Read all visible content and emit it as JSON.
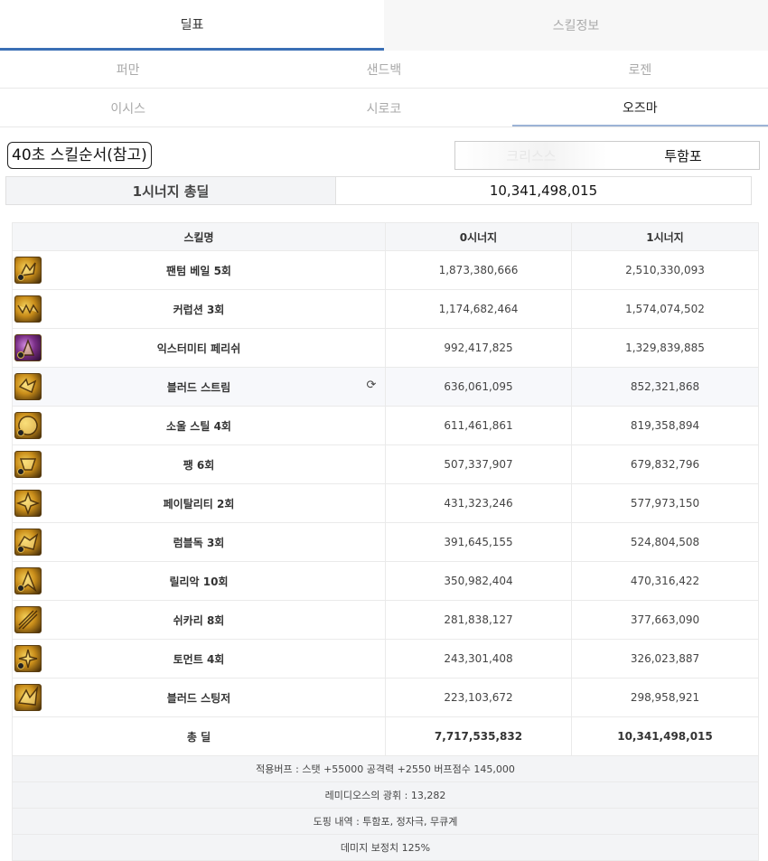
{
  "top_tabs": [
    {
      "label": "딜표",
      "active": true
    },
    {
      "label": "스킬정보",
      "active": false
    }
  ],
  "boss_rows": [
    [
      {
        "label": "퍼만",
        "active": false
      },
      {
        "label": "샌드백",
        "active": false
      },
      {
        "label": "로젠",
        "active": false
      }
    ],
    [
      {
        "label": "이시스",
        "active": false
      },
      {
        "label": "시로코",
        "active": false
      },
      {
        "label": "오즈마",
        "active": true
      }
    ]
  ],
  "skill_order_label": "40초 스킬순서(참고)",
  "mode_toggle": {
    "options": [
      "크리스스",
      "투함포"
    ],
    "selected": "투함포"
  },
  "total": {
    "label": "1시너지 총딜",
    "value": "10,341,498,015"
  },
  "table": {
    "headers": [
      "스킬명",
      "0시너지",
      "1시너지"
    ],
    "rows": [
      {
        "name": "팬텀 베일 5회",
        "s0": "1,873,380,666",
        "s1": "2,510,330,093",
        "icon": "phantom-veil-icon"
      },
      {
        "name": "커럽션 3회",
        "s0": "1,174,682,464",
        "s1": "1,574,074,502",
        "icon": "corruption-icon"
      },
      {
        "name": "익스터미티 페리쉬",
        "s0": "992,417,825",
        "s1": "1,329,839,885",
        "icon": "extremity-perish-icon"
      },
      {
        "name": "블러드 스트림",
        "s0": "636,061,095",
        "s1": "852,321,868",
        "icon": "blood-stream-icon"
      },
      {
        "name": "소울 스틸 4회",
        "s0": "611,461,861",
        "s1": "819,358,894",
        "icon": "soul-steal-icon"
      },
      {
        "name": "팽 6회",
        "s0": "507,337,907",
        "s1": "679,832,796",
        "icon": "fang-icon"
      },
      {
        "name": "페이탈리티 2회",
        "s0": "431,323,246",
        "s1": "577,973,150",
        "icon": "fatality-icon"
      },
      {
        "name": "럼블독 3회",
        "s0": "391,645,155",
        "s1": "524,804,508",
        "icon": "rumble-dog-icon"
      },
      {
        "name": "릴리악 10회",
        "s0": "350,982,404",
        "s1": "470,316,422",
        "icon": "liliac-icon"
      },
      {
        "name": "쉬카리 8회",
        "s0": "281,838,127",
        "s1": "377,663,090",
        "icon": "shikari-icon"
      },
      {
        "name": "토먼트 4회",
        "s0": "243,301,408",
        "s1": "326,023,887",
        "icon": "torment-icon"
      },
      {
        "name": "블러드 스팅저",
        "s0": "223,103,672",
        "s1": "298,958,921",
        "icon": "blood-stinger-icon"
      }
    ],
    "total": {
      "name": "총 딜",
      "s0": "7,717,535,832",
      "s1": "10,341,498,015"
    },
    "info": [
      "적용버프 : 스탯 +55000 공격력 +2550 버프점수 145,000",
      "레미디오스의 광휘 : 13,282",
      "도핑 내역 : 투함포, 정자극, 무큐계",
      "데미지 보정치 125%"
    ]
  }
}
